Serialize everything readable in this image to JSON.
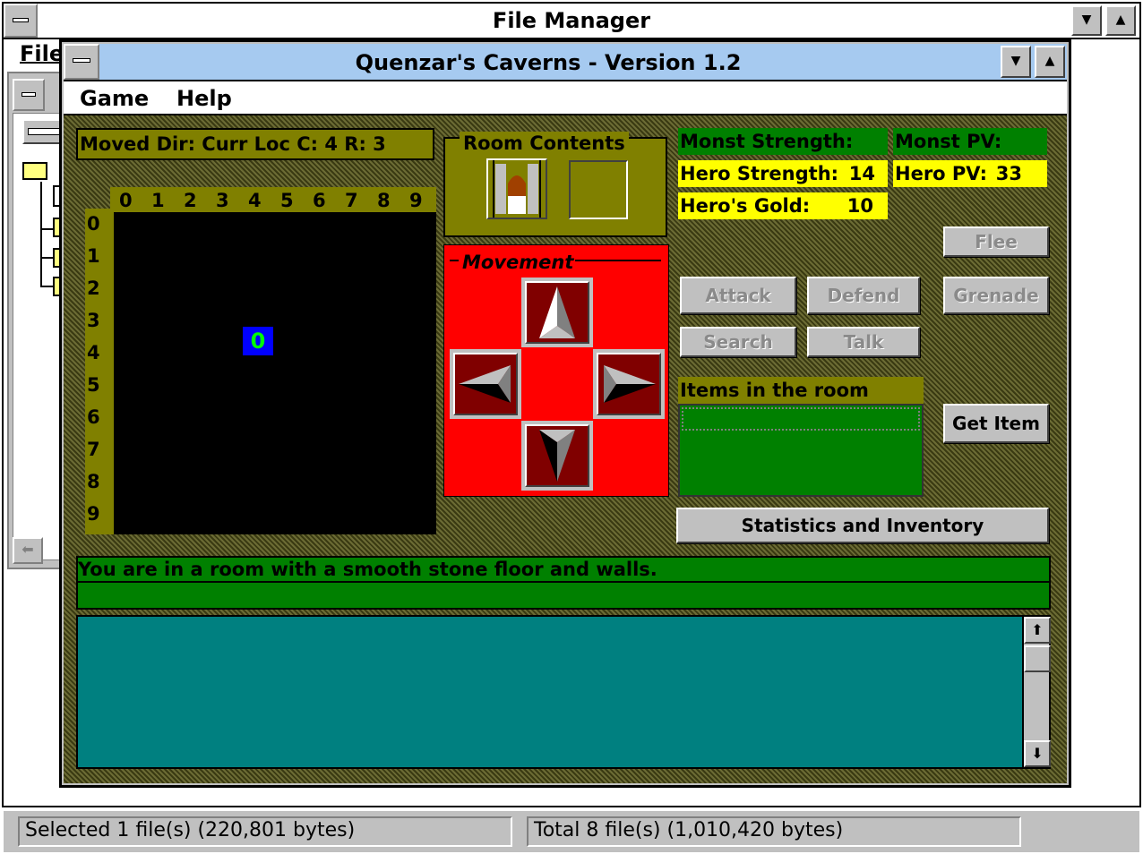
{
  "file_manager": {
    "title": "File Manager",
    "menu_file": "File",
    "status_selected": "Selected 1 file(s) (220,801 bytes)",
    "status_total": "Total 8 file(s) (1,010,420 bytes)"
  },
  "game": {
    "title": "Quenzar's Caverns - Version 1.2",
    "menu": {
      "game": "Game",
      "help": "Help"
    },
    "moved_dir": "Moved Dir:  Curr Loc C: 4 R: 3",
    "room_contents_label": "Room Contents",
    "movement_label": "Movement",
    "monst_strength_label": "Monst Strength:",
    "monst_pv_label": "Monst PV:",
    "hero_strength_label": "Hero Strength:",
    "hero_strength_value": "14",
    "hero_pv_label": "Hero PV:",
    "hero_pv_value": "33",
    "hero_gold_label": "Hero's Gold:",
    "hero_gold_value": "10",
    "map_cols": [
      "0",
      "1",
      "2",
      "3",
      "4",
      "5",
      "6",
      "7",
      "8",
      "9"
    ],
    "map_rows": [
      "0",
      "1",
      "2",
      "3",
      "4",
      "5",
      "6",
      "7",
      "8",
      "9"
    ],
    "hero_marker": "0",
    "hero_position": {
      "col": 4,
      "row": 3
    },
    "buttons": {
      "flee": "Flee",
      "attack": "Attack",
      "defend": "Defend",
      "grenade": "Grenade",
      "search": "Search",
      "talk": "Talk",
      "get_item": "Get Item",
      "stats": "Statistics and Inventory"
    },
    "items_label": "Items in the room",
    "message": "You are in a room with a smooth stone floor and walls.",
    "scroll_up": "⬆",
    "scroll_down": "⬇"
  },
  "colors": {
    "olive": "#808000",
    "green": "#008000",
    "yellow": "#ffff00",
    "red": "#ff0000",
    "teal": "#008080",
    "maroon": "#800000",
    "titlebar": "#a6caf0"
  }
}
